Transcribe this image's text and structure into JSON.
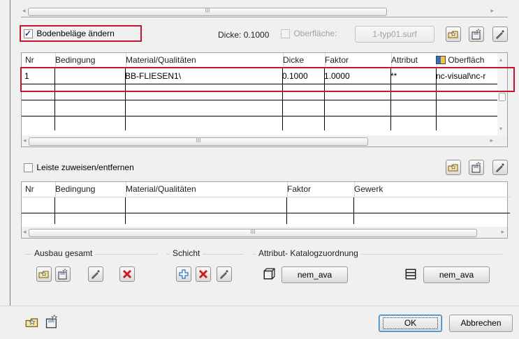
{
  "grid1": {
    "columns": [
      "Nr",
      "Bedingung",
      "Material/Qualitäten",
      "Dicke",
      "Faktor",
      "Attribut",
      "Oberfläch"
    ],
    "row": {
      "nr": "1",
      "bedingung": "",
      "material": "BB-FLIESEN1\\",
      "dicke": "0.1000",
      "faktor": "1.0000",
      "attribut": "**",
      "oberflaeche": "nc-visual\\nc-r"
    }
  },
  "boden": {
    "label": "Bodenbeläge ändern",
    "checked": true
  },
  "dicke_label": "Dicke:",
  "dicke_value": "0.1000",
  "oberflaeche_label": "Oberfläche:",
  "surface_button": "1-typ01.surf",
  "leiste": {
    "label": "Leiste zuweisen/entfernen",
    "checked": false
  },
  "grid2": {
    "columns": [
      "Nr",
      "Bedingung",
      "Material/Qualitäten",
      "Faktor",
      "Gewerk"
    ]
  },
  "groups": {
    "ausbau": "Ausbau gesamt",
    "schicht": "Schicht",
    "attribut": "Attribut- Katalogzuordnung"
  },
  "nem_ava_left": "nem_ava",
  "nem_ava_right": "nem_ava",
  "footer": {
    "ok": "OK",
    "cancel": "Abbrechen"
  },
  "scroll_grip": "III",
  "colors": {
    "highlight_red": "#c0152f",
    "grid_border": "#a0a0a0",
    "delete_red": "#cc1b1b",
    "plus_blue": "#2a6fc0"
  }
}
